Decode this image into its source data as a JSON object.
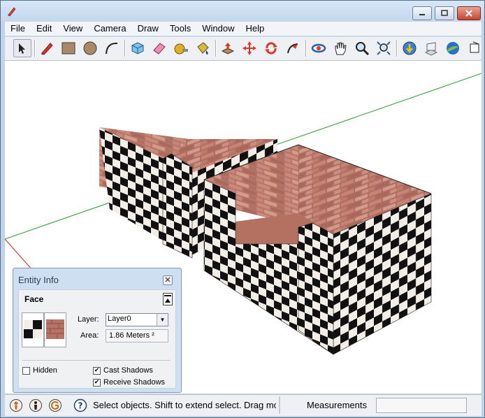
{
  "menu": [
    "File",
    "Edit",
    "View",
    "Camera",
    "Draw",
    "Tools",
    "Window",
    "Help"
  ],
  "toolbar_icons": [
    "select-arrow-icon",
    "pencil-icon",
    "rectangle-icon",
    "circle-icon",
    "arc-icon",
    "make-component-icon",
    "eraser-icon",
    "tape-measure-icon",
    "paint-bucket-icon",
    "push-pull-icon",
    "move-icon",
    "rotate-icon",
    "follow-me-icon",
    "orbit-icon",
    "pan-icon",
    "zoom-icon",
    "zoom-extents-icon",
    "get-models-icon",
    "share-model-icon",
    "google-earth-icon"
  ],
  "entity_info": {
    "title": "Entity Info",
    "type": "Face",
    "layer_label": "Layer:",
    "layer_value": "Layer0",
    "area_label": "Area:",
    "area_value": "1.86 Meters ²",
    "hidden_label": "Hidden",
    "hidden_checked": false,
    "cast_shadows_label": "Cast Shadows",
    "cast_shadows_checked": true,
    "receive_shadows_label": "Receive Shadows",
    "receive_shadows_checked": true
  },
  "status": {
    "text": "Select objects. Shift to extend select. Drag mouse to select multiple.",
    "measurements_label": "Measurements",
    "measurements_value": ""
  },
  "colors": {
    "green_axis": "#2a9a2a",
    "red_axis": "#d21e1e",
    "brick": "#b77466"
  }
}
